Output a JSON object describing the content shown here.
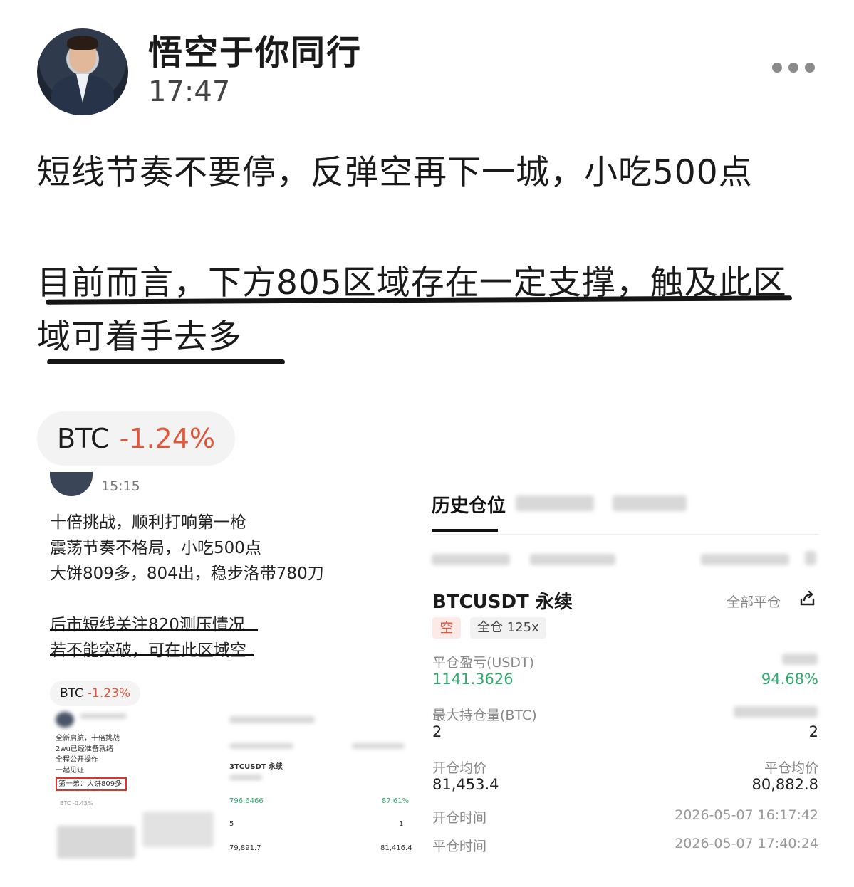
{
  "author": {
    "name": "悟空于你同行",
    "time": "17:47"
  },
  "post": {
    "line1": "短线节奏不要停，反弹空再下一城，小吃500点",
    "para2": "目前而言，下方805区域存在一定支撑，触及此区域可着手去多"
  },
  "ticker": {
    "symbol": "BTC",
    "change": "-1.24%",
    "change_color": "#e0563a"
  },
  "embedded_post": {
    "time": "15:15",
    "lines": [
      "十倍挑战，顺利打响第一枪",
      "震荡节奏不格局，小吃500点",
      "大饼809多，804出，稳步洛带780刀",
      "",
      "后市短线关注820测压情况",
      "若不能突破，可在此区域空"
    ],
    "ticker": {
      "symbol": "BTC",
      "change": "-1.23%"
    }
  },
  "nested_screenshot": {
    "lines": [
      "全新启航，十倍挑战",
      "2wu已经准备就绪",
      "全程公开操作",
      "一起见证"
    ],
    "highlight": "第一弟：大饼809多",
    "ticker": "BTC -0.43%",
    "symbol": "3TCUSDT 永续",
    "values": [
      "796.6466",
      "87.61%",
      "5",
      "1",
      "79,891.7",
      "81,416.4"
    ]
  },
  "position": {
    "tab": "历史仓位",
    "symbol": "BTCUSDT 永续",
    "close_all": "全部平仓",
    "side": "空",
    "margin": "全仓 125x",
    "pnl_label": "平仓盈亏(USDT)",
    "pnl_value": "1141.3626",
    "roi_value": "94.68%",
    "max_hold_label": "最大持仓量(BTC)",
    "max_hold_value": "2",
    "closed_qty_value": "2",
    "open_avg_label": "开仓均价",
    "open_avg_value": "81,453.4",
    "close_avg_label": "平仓均价",
    "close_avg_value": "80,882.8",
    "open_time_label": "开仓时间",
    "open_time_value": "2026-05-07 16:17:42",
    "close_time_label": "平仓时间",
    "close_time_value": "2026-05-07 17:40:24"
  },
  "icons": {
    "more": "more-dots-icon",
    "share": "share-icon"
  }
}
